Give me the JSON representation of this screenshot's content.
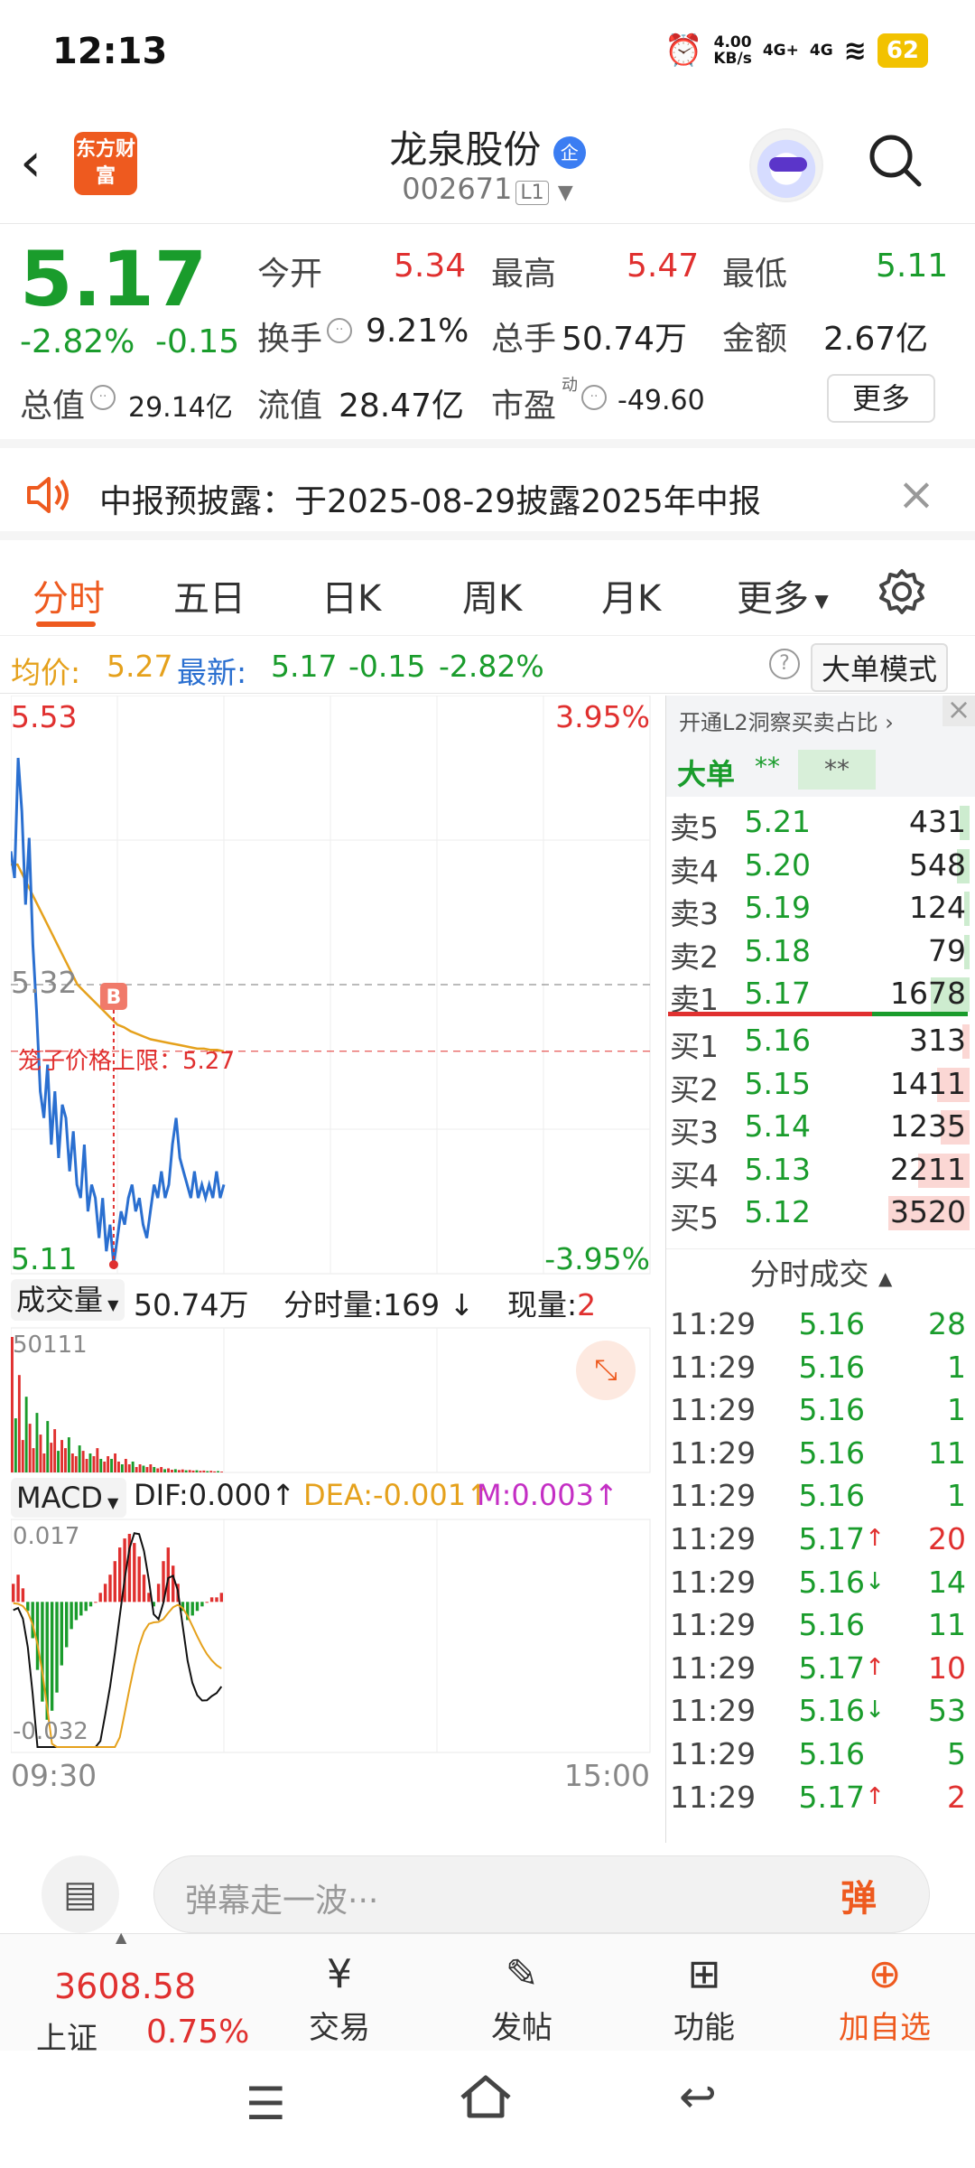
{
  "status_bar": {
    "time": "12:13",
    "speed": "4.00",
    "speed_unit": "KB/s",
    "net1": "4G+",
    "net2": "4G",
    "battery": "62"
  },
  "header": {
    "logo": "东方财富",
    "title": "龙泉股份",
    "badge": "企",
    "code": "002671",
    "level": "L1"
  },
  "quote": {
    "price": "5.17",
    "change_pct": "-2.82%",
    "change": "-0.15",
    "open_label": "今开",
    "open": "5.34",
    "high_label": "最高",
    "high": "5.47",
    "low_label": "最低",
    "low": "5.11",
    "turnover_label": "换手",
    "turnover": "9.21%",
    "volume_label": "总手",
    "volume": "50.74万",
    "amount_label": "金额",
    "amount": "2.67亿",
    "mktcap_label": "总值",
    "mktcap": "29.14亿",
    "float_label": "流值",
    "float": "28.47亿",
    "pe_label": "市盈",
    "pe_sup": "动",
    "pe": "-49.60",
    "more": "更多"
  },
  "notice": {
    "text": "中报预披露：于2025-08-29披露2025年中报"
  },
  "tabs": {
    "items": [
      "分时",
      "五日",
      "日K",
      "周K",
      "月K",
      "更多"
    ],
    "active": 0
  },
  "info_line": {
    "avg_label": "均价:",
    "avg": "5.27",
    "latest_label": "最新:",
    "latest": "5.17",
    "chg": "-0.15",
    "pct": "-2.82%",
    "mode": "大单模式"
  },
  "chart_data": [
    {
      "type": "line",
      "title": "分时",
      "ylim": [
        5.11,
        5.53
      ],
      "y_top_label": "5.53",
      "y_mid_label": "5.32",
      "y_bottom_label": "5.11",
      "pct_top": "3.95%",
      "pct_bottom": "-3.95%",
      "cage_label": "笼子价格上限：5.27",
      "cage_value": 5.27,
      "buy_marker": "B",
      "series": [
        {
          "name": "",
          "values": [
            5.42,
            5.4,
            5.49,
            5.45,
            5.38,
            5.43,
            5.35,
            5.3,
            5.24,
            5.22,
            5.26,
            5.2,
            5.24,
            5.19,
            5.23,
            5.22,
            5.18,
            5.21,
            5.17,
            5.16,
            5.2,
            5.15,
            5.17,
            5.16,
            5.13,
            5.16,
            5.12,
            5.14,
            5.11,
            5.13,
            5.15,
            5.14,
            5.16,
            5.17,
            5.15,
            5.16,
            5.14,
            5.13,
            5.15,
            5.17,
            5.16,
            5.18,
            5.16,
            5.17,
            5.2,
            5.22,
            5.19,
            5.18,
            5.17,
            5.16,
            5.18,
            5.16,
            5.17,
            5.16,
            5.17,
            5.16,
            5.18,
            5.16,
            5.17
          ]
        },
        {
          "name": "均价",
          "values": [
            5.41,
            5.41,
            5.4,
            5.39,
            5.38,
            5.37,
            5.36,
            5.35,
            5.34,
            5.33,
            5.32,
            5.315,
            5.31,
            5.305,
            5.3,
            5.295,
            5.29,
            5.288,
            5.285,
            5.283,
            5.281,
            5.279,
            5.278,
            5.277,
            5.276,
            5.275,
            5.274,
            5.273,
            5.272,
            5.272,
            5.271,
            5.271,
            5.27
          ]
        }
      ]
    },
    {
      "type": "bar",
      "title": "成交量",
      "total": "50.74万",
      "interval_vol_label": "分时量:169",
      "now_label": "现量:",
      "now": "2",
      "ymax_label": "50111",
      "values": [
        50111,
        20000,
        36000,
        12000,
        28000,
        18000,
        9000,
        22000,
        14000,
        7000,
        19000,
        11000,
        16000,
        8000,
        12000,
        9000,
        13000,
        7000,
        6000,
        10000,
        8000,
        5000,
        7000,
        6000,
        9000,
        5000,
        4000,
        6000,
        5000,
        7000,
        4000,
        3000,
        5000,
        3000,
        4000,
        2000,
        3000,
        2500,
        2000,
        3000,
        2000,
        1500,
        2000,
        1200,
        1500,
        1000,
        1200,
        900,
        1100,
        800,
        900,
        700,
        800,
        600,
        700,
        500,
        600,
        400,
        500,
        300
      ]
    },
    {
      "type": "bar",
      "title": "MACD",
      "dif": "DIF:0.000",
      "dea": "DEA:-0.001",
      "m": "M:0.003",
      "ymax_label": "0.017",
      "ymin_label": "-0.032",
      "values": [
        0.004,
        0.006,
        0.003,
        -0.002,
        -0.008,
        -0.015,
        -0.022,
        -0.026,
        -0.024,
        -0.02,
        -0.014,
        -0.01,
        -0.006,
        -0.004,
        -0.003,
        -0.002,
        -0.001,
        0.0,
        0.002,
        0.004,
        0.006,
        0.009,
        0.012,
        0.014,
        0.015,
        0.013,
        0.01,
        0.006,
        0.002,
        -0.001,
        0.004,
        0.009,
        0.012,
        0.008,
        0.004,
        -0.002,
        -0.004,
        -0.003,
        -0.002,
        -0.001,
        0.0,
        0.001,
        0.001,
        0.002
      ]
    }
  ],
  "time_axis": {
    "start": "09:30",
    "end": "15:00"
  },
  "order_book": {
    "l2_hint": "开通L2洞察买卖占比",
    "big_label": "大单",
    "big_v1": "**",
    "big_v2": "**",
    "asks": [
      {
        "label": "卖5",
        "price": "5.21",
        "vol": "431"
      },
      {
        "label": "卖4",
        "price": "5.20",
        "vol": "548"
      },
      {
        "label": "卖3",
        "price": "5.19",
        "vol": "124"
      },
      {
        "label": "卖2",
        "price": "5.18",
        "vol": "79"
      },
      {
        "label": "卖1",
        "price": "5.17",
        "vol": "1678"
      }
    ],
    "bids": [
      {
        "label": "买1",
        "price": "5.16",
        "vol": "313"
      },
      {
        "label": "买2",
        "price": "5.15",
        "vol": "1411"
      },
      {
        "label": "买3",
        "price": "5.14",
        "vol": "1235"
      },
      {
        "label": "买4",
        "price": "5.13",
        "vol": "2211"
      },
      {
        "label": "买5",
        "price": "5.12",
        "vol": "3520"
      }
    ],
    "ticks_title": "分时成交",
    "ticks": [
      {
        "time": "11:29",
        "price": "5.16",
        "arrow": "",
        "vol": "28"
      },
      {
        "time": "11:29",
        "price": "5.16",
        "arrow": "",
        "vol": "1"
      },
      {
        "time": "11:29",
        "price": "5.16",
        "arrow": "",
        "vol": "1"
      },
      {
        "time": "11:29",
        "price": "5.16",
        "arrow": "",
        "vol": "11"
      },
      {
        "time": "11:29",
        "price": "5.16",
        "arrow": "",
        "vol": "1"
      },
      {
        "time": "11:29",
        "price": "5.17",
        "arrow": "↑",
        "vol": "20"
      },
      {
        "time": "11:29",
        "price": "5.16",
        "arrow": "↓",
        "vol": "14"
      },
      {
        "time": "11:29",
        "price": "5.16",
        "arrow": "",
        "vol": "11"
      },
      {
        "time": "11:29",
        "price": "5.17",
        "arrow": "↑",
        "vol": "10"
      },
      {
        "time": "11:29",
        "price": "5.16",
        "arrow": "↓",
        "vol": "53"
      },
      {
        "time": "11:29",
        "price": "5.16",
        "arrow": "",
        "vol": "5"
      },
      {
        "time": "11:29",
        "price": "5.17",
        "arrow": "↑",
        "vol": "2"
      }
    ]
  },
  "danmu": {
    "placeholder": "弹幕走一波···",
    "btn": "弹"
  },
  "bottom_nav": {
    "index_value": "3608.58",
    "index_name": "上证",
    "index_pct": "0.75%",
    "trade": "交易",
    "post": "发帖",
    "func": "功能",
    "add": "加自选"
  },
  "colors": {
    "up": "#e0302f",
    "down": "#1a9c2c",
    "accent": "#ee5a1f",
    "price_line": "#2a6fd0",
    "avg_line": "#e5a11c"
  }
}
